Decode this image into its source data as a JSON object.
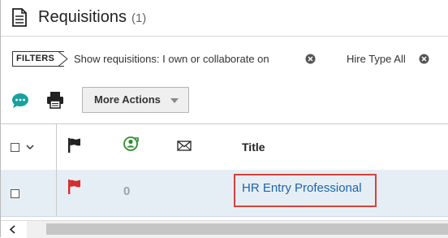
{
  "header": {
    "title": "Requisitions",
    "count": "(1)"
  },
  "filters": {
    "pill_label": "FILTERS",
    "items": [
      {
        "label": "Show requisitions: I own or collaborate on"
      },
      {
        "label": "Hire Type All"
      }
    ]
  },
  "toolbar": {
    "more_actions_label": "More Actions"
  },
  "table": {
    "columns": [
      "",
      "",
      "",
      "",
      "Title"
    ],
    "rows": [
      {
        "count_value": "0",
        "title": "HR Entry Professional"
      }
    ]
  },
  "colors": {
    "flag_header": "#222222",
    "flag_row": "#d32f2f",
    "link": "#1b63b0",
    "highlight": "#d9413c",
    "chat_icon": "#1aa0a0"
  },
  "icons": [
    "document-icon",
    "chevron-right-icon",
    "close-circle-icon",
    "chat-icon",
    "print-icon",
    "caret-down-icon",
    "checkbox-icon",
    "flag-icon",
    "collaborator-icon",
    "envelope-icon",
    "scroll-left-icon"
  ]
}
